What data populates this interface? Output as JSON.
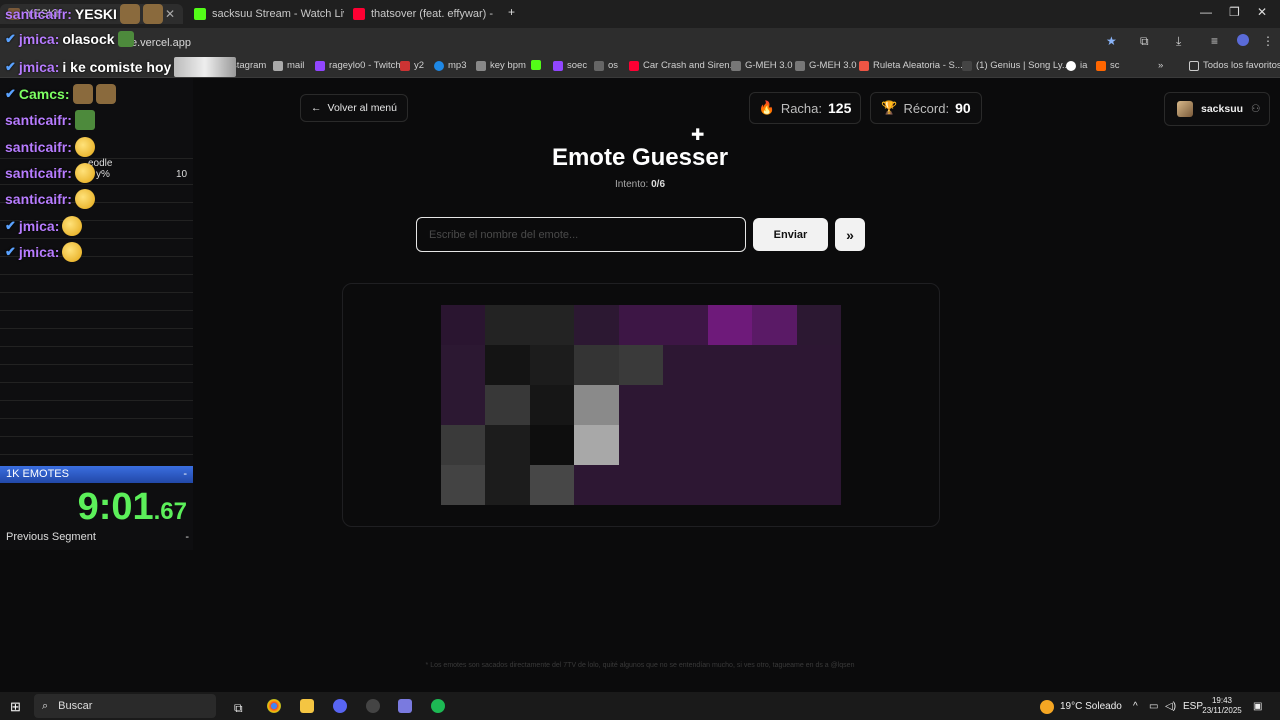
{
  "browser": {
    "tabs": [
      {
        "label": "YESKI"
      },
      {
        "label": "sacksuu Stream - Watch Live o"
      },
      {
        "label": "thatsover (feat. effywar) -"
      }
    ],
    "url": "elle.vercel.app",
    "bookmarks": [
      "stagram",
      "mail",
      "rageylo0 - Twitch",
      "y2",
      "mp3",
      "key bpm",
      "soec",
      "os",
      "Car Crash and Siren...",
      "G-MEH 3.0",
      "G-MEH 3.0",
      "Ruleta Aleatoria - S...",
      "(1) Genius | Song Ly...",
      "ia",
      "sc",
      "Todos los favoritos"
    ]
  },
  "chat": [
    {
      "user": "santicaifr:",
      "msg": "YESKI"
    },
    {
      "user": "jmica:",
      "msg": "olasock"
    },
    {
      "user": "jmica:",
      "msg": "i ke comiste hoy"
    },
    {
      "user": "Camcs:",
      "msg": ""
    },
    {
      "user": "santicaifr:",
      "msg": ""
    },
    {
      "user": "santicaifr:",
      "msg": ""
    },
    {
      "user": "santicaifr:",
      "msg": ""
    },
    {
      "user": "santicaifr:",
      "msg": ""
    },
    {
      "user": "jmica:",
      "msg": ""
    },
    {
      "user": "jmica:",
      "msg": ""
    }
  ],
  "splits": {
    "row_label": "eodle",
    "row_sub": "y%",
    "row_value": "10",
    "header": "1K EMOTES",
    "header_dash": "-",
    "timer_main": "9:01",
    "timer_frac": ".67",
    "prev_label": "Previous Segment",
    "prev_value": "-"
  },
  "app": {
    "back_label": "Volver al menú",
    "streak_label": "Racha:",
    "streak_value": "125",
    "record_label": "Récord:",
    "record_value": "90",
    "username": "sacksuu",
    "title": "Emote Guesser",
    "attempt_label": "Intento:",
    "attempt_value": "0/6",
    "input_placeholder": "Escribe el nombre del emote...",
    "send_label": "Enviar",
    "skip_label": "»",
    "footnote": "* Los emotes son sacados directamente del 7TV de lolo, quité algunos que no se entendían mucho, si ves otro, tagueame en ds a @lqsen"
  },
  "pixel_colors": [
    "#2a1530",
    "#232323",
    "#232323",
    "#2c1832",
    "#3d1645",
    "#3d1645",
    "#6e1a7a",
    "#5a1a66",
    "#2c1832",
    "#2c1832",
    "#141414",
    "#1c1c1c",
    "#343434",
    "#3a3a3a",
    "#2d1733",
    "#2d1733",
    "#2d1733",
    "#2d1733",
    "#2c1832",
    "#383838",
    "#161616",
    "#8a8a8a",
    "#2d1733",
    "#2d1733",
    "#2d1733",
    "#2d1733",
    "#2d1733",
    "#3a3a3a",
    "#1c1c1c",
    "#0e0e0e",
    "#a8a8a8",
    "#2d1733",
    "#2d1733",
    "#2d1733",
    "#2d1733",
    "#2d1733",
    "#434343",
    "#1c1c1c",
    "#474747",
    "#2d1733",
    "#2d1733",
    "#2d1733",
    "#2d1733",
    "#2d1733",
    "#2d1733"
  ],
  "taskbar": {
    "search_label": "Buscar",
    "weather": "19°C  Soleado",
    "lang": "ESP",
    "time": "19:43",
    "date": "23/11/2025"
  }
}
